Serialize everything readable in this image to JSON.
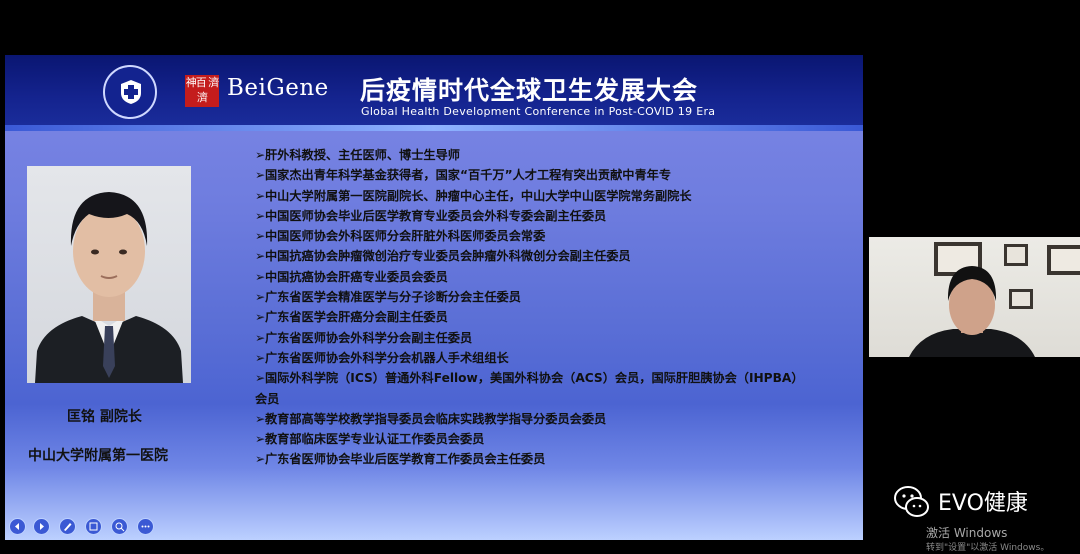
{
  "slide": {
    "brand": "BeiGene",
    "seal_text": "神百 濟濟",
    "conference_title_zh": "后疫情时代全球卫生发展大会",
    "conference_title_en": "Global Health Development Conference in Post-COVID 19 Era",
    "speaker_name": "匡铭 副院长",
    "speaker_affiliation": "中山大学附属第一医院",
    "bullet_marker": "➢",
    "bullets": [
      "肝外科教授、主任医师、博士生导师",
      "国家杰出青年科学基金获得者，国家“百千万”人才工程有突出贡献中青年专",
      "中山大学附属第一医院副院长、肿瘤中心主任，中山大学中山医学院常务副院长",
      "中国医师协会毕业后医学教育专业委员会外科专委会副主任委员",
      "中国医师协会外科医师分会肝脏外科医师委员会常委",
      "中国抗癌协会肿瘤微创治疗专业委员会肿瘤外科微创分会副主任委员",
      "中国抗癌协会肝癌专业委员会委员",
      "广东省医学会精准医学与分子诊断分会主任委员",
      "广东省医学会肝癌分会副主任委员",
      "广东省医师协会外科学分会副主任委员",
      "广东省医师协会外科学分会机器人手术组组长",
      "国际外科学院（ICS）普通外科Fellow，美国外科协会（ACS）会员，国际肝胆胰协会（IHPBA）会员",
      "教育部高等学校教学指导委员会临床实践教学指导分委员会委员",
      "教育部临床医学专业认证工作委员会委员",
      "广东省医师协会毕业后医学教育工作委员会主任委员"
    ]
  },
  "watermark": {
    "text": "EVO健康",
    "icon": "wechat-icon"
  },
  "windows_activation": {
    "line1": "激活 Windows",
    "line2": "转到\"设置\"以激活 Windows。"
  },
  "colors": {
    "banner": "#0f1d80",
    "slide_bg": "#6477dc",
    "seal": "#c41c1c"
  }
}
